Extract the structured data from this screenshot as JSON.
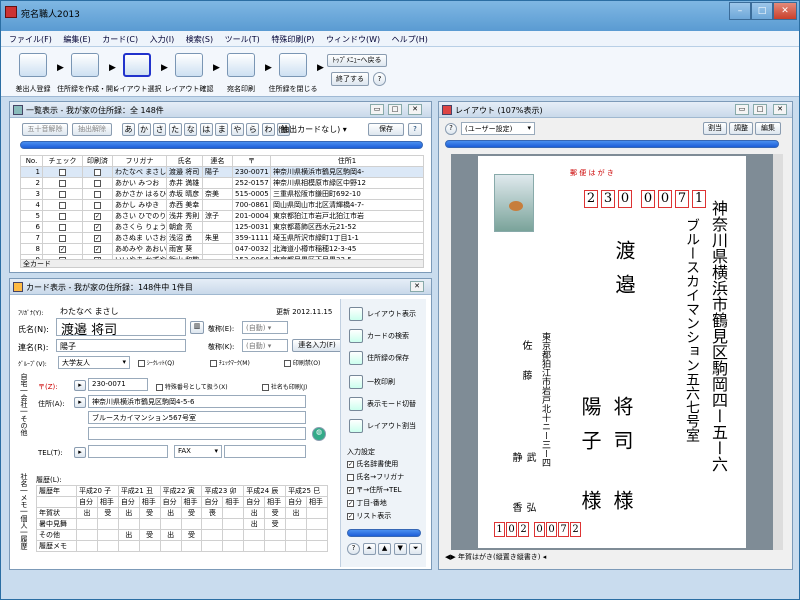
{
  "window": {
    "title": "宛名職人2013"
  },
  "menu": [
    "ファイル(F)",
    "編集(E)",
    "カード(C)",
    "入力(I)",
    "検索(S)",
    "ツール(T)",
    "特殊印刷(P)",
    "ウィンドウ(W)",
    "ヘルプ(H)"
  ],
  "toolbar": {
    "steps": [
      "差出人登録",
      "住所録を作成・開く",
      "レイアウト選択",
      "レイアウト確認",
      "宛名印刷",
      "住所録を閉じる"
    ],
    "top_menu": "ﾄｯﾌﾟﾒﾆｭｰへ戻る",
    "exit": "終了する"
  },
  "list_panel": {
    "title": "一覧表示 - 我が家の住所録：全 148件",
    "btn_50on": "五十音解除",
    "btn_extract": "抽出解除",
    "kana_tabs": [
      "あ",
      "か",
      "さ",
      "た",
      "な",
      "は",
      "ま",
      "や",
      "ら",
      "わ",
      "他"
    ],
    "extract_label": "(抽出カードなし)",
    "save": "保存",
    "columns": [
      "No.",
      "チェック",
      "印刷済",
      "フリガナ",
      "氏名",
      "連名",
      "〒",
      "住所1"
    ],
    "rows": [
      {
        "no": "1",
        "check": false,
        "printed": false,
        "kana": "わたなべ まさし",
        "name": "渡邉 将司",
        "renmei": "陽子",
        "zip": "230-0071",
        "addr": "神奈川県横浜市鶴見区駒岡4-"
      },
      {
        "no": "2",
        "check": false,
        "printed": false,
        "kana": "あかい みつお",
        "name": "赤井 満雄",
        "renmei": "",
        "zip": "252-0157",
        "addr": "神奈川県相模原市緑区中野12"
      },
      {
        "no": "3",
        "check": false,
        "printed": false,
        "kana": "あかさか はるひこ",
        "name": "赤坂 晴彦",
        "renmei": "奈美",
        "zip": "515-0005",
        "addr": "三重県松阪市鎌田町692-10"
      },
      {
        "no": "4",
        "check": false,
        "printed": false,
        "kana": "あかし みゆき",
        "name": "赤西 美幸",
        "renmei": "",
        "zip": "700-0861",
        "addr": "岡山県岡山市北区清輝橋4-7-"
      },
      {
        "no": "5",
        "check": false,
        "printed": true,
        "kana": "あさい ひでのり",
        "name": "浅井 秀則",
        "renmei": "涼子",
        "zip": "201-0004",
        "addr": "東京都狛江市岩戸北狛江市岩"
      },
      {
        "no": "6",
        "check": false,
        "printed": true,
        "kana": "あさくら りょう",
        "name": "朝倉 亮",
        "renmei": "",
        "zip": "125-0031",
        "addr": "東京都葛飾区西水元21-52"
      },
      {
        "no": "7",
        "check": false,
        "printed": true,
        "kana": "あさぬま いさお",
        "name": "浅沼 勇",
        "renmei": "朱里",
        "zip": "359-1111",
        "addr": "埼玉県所沢市緑町1丁目1-1"
      },
      {
        "no": "8",
        "check": true,
        "printed": true,
        "kana": "あめみや あおい",
        "name": "雨宮 葵",
        "renmei": "",
        "zip": "047-0032",
        "addr": "北海道小樽市稲穂12-3-45"
      },
      {
        "no": "9",
        "check": false,
        "printed": true,
        "kana": "いいやま かずや",
        "name": "飯山 和敬",
        "renmei": "",
        "zip": "153-0064",
        "addr": "東京都目黒区下目黒33-5"
      }
    ],
    "footer": "全カード"
  },
  "card_panel": {
    "title": "カード表示 - 我が家の住所録：148件中 1件目",
    "kana_label": "ﾌﾘｶﾞﾅ(Y):",
    "kana": "わたなべ まさし",
    "updated": "更新 2012.11.15",
    "name_label": "氏名(N):",
    "name": "渡邉 将司",
    "keisho_label": "敬称(E):",
    "keisho": "(自動)",
    "renmei_label": "連名(R):",
    "renmei": "陽子",
    "keisho2_label": "敬称(K):",
    "keisho2": "(自動)",
    "renmei_btn": "連名入力(F)",
    "group_label": "ｸﾞﾙｰﾌﾟ(V):",
    "group": "大学友人",
    "seal_label": "ｼｰｸﾚｯﾄ(Q)",
    "checkmark_label": "ﾁｪｯｸﾏｰｸ(M)",
    "print_ban_label": "印刷禁(O)",
    "side_tabs": [
      "自宅",
      "会社",
      "その他",
      "社名",
      "メモ",
      "個人",
      "履歴"
    ],
    "zip_label": "〒(Z):",
    "zip": "230-0071",
    "special_label": "特殊番号として扱う(X)",
    "company_print_label": "社名も印刷(J)",
    "addr_label": "住所(A):",
    "addr1": "神奈川県横浜市鶴見区駒岡4-5-6",
    "addr2": "ブルースカイマンション567号室",
    "tel_label": "TEL(T):",
    "fax_label": "FAX",
    "history_label": "履歴(L):",
    "history_header": [
      "履歴年",
      "平成20 子",
      "平成21 丑",
      "平成22 寅",
      "平成23 卯",
      "平成24 辰",
      "平成25 巳"
    ],
    "history_sub": [
      "自分",
      "相手",
      "自分",
      "相手",
      "自分",
      "相手",
      "自分",
      "相手",
      "自分",
      "相手",
      "自分",
      "相手"
    ],
    "history_rows": [
      {
        "label": "年賀状",
        "cells": [
          "出",
          "受",
          "出",
          "受",
          "出",
          "受",
          "喪",
          "",
          "出",
          "受",
          "出",
          ""
        ]
      },
      {
        "label": "暑中見舞",
        "cells": [
          "",
          "",
          "",
          "",
          "",
          "",
          "",
          "",
          "出",
          "受",
          "",
          ""
        ]
      },
      {
        "label": "その他",
        "cells": [
          "",
          "",
          "出",
          "受",
          "出",
          "受",
          "",
          "",
          "",
          "",
          "",
          ""
        ]
      },
      {
        "label": "履歴メモ",
        "cells": [
          "",
          "",
          "",
          "",
          "",
          "",
          "",
          "",
          "",
          "",
          "",
          ""
        ]
      }
    ],
    "side_buttons": [
      "レイアウト表示",
      "カードの検索",
      "住所録の保存",
      "一枚印刷",
      "表示モード切替",
      "レイアウト割当"
    ],
    "input_settings_label": "入力設定",
    "input_settings": [
      {
        "label": "氏名辞書使用",
        "checked": true
      },
      {
        "label": "氏名→フリガナ",
        "checked": false
      },
      {
        "label": "〒→住所→TEL",
        "checked": true
      },
      {
        "label": "丁目-番地",
        "checked": true
      },
      {
        "label": "リスト表示",
        "checked": true
      }
    ]
  },
  "layout_panel": {
    "title": "レイアウト (107%表示)",
    "user_setting": "(ユーザー設定)",
    "btn_assign": "割当",
    "btn_adjust": "調整",
    "btn_edit": "編集",
    "postcard_label": "郵 便 は が き",
    "zip_digits": [
      "2",
      "3",
      "0",
      "0",
      "0",
      "7",
      "1"
    ],
    "address_line1": "神奈川県横浜市鶴見区駒岡四ー五ー六",
    "address_line2": "ブルースカイマンション五六七号室",
    "recipient_surname": "渡邉",
    "recipient_name1": "将司",
    "recipient_name2": "陽子",
    "honorific1": "様",
    "honorific2": "様",
    "sender_address": "東京都狛江市岩戸北十ニー三ー四",
    "sender_surname": "佐藤",
    "sender_name1": "武",
    "sender_name2": "弘",
    "sender_given1": "静",
    "sender_given2": "香",
    "sender_zip": [
      "1",
      "0",
      "2",
      "0",
      "0",
      "7",
      "2"
    ],
    "footer": "年賀はがき(縦置き縦書き)"
  }
}
